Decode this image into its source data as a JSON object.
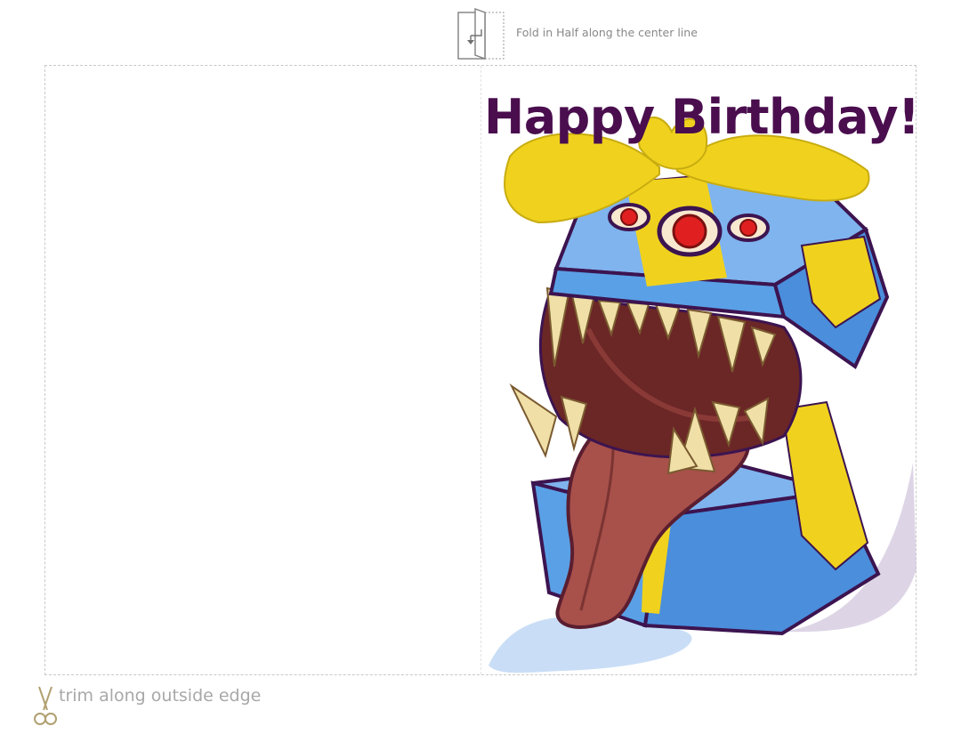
{
  "fold_instruction": {
    "icon": "fold-icon",
    "text": "Fold in Half along the center line"
  },
  "card": {
    "front_title": "Happy Birthday!",
    "illustration": "gift-box-mimic-monster",
    "colors": {
      "title": "#4a0e4e",
      "box_blue": "#5aa0e6",
      "ribbon_yellow": "#f0d21e",
      "outline": "#3c1450",
      "tongue": "#a8504a",
      "mouth": "#6b2626",
      "teeth": "#f0e0a8",
      "eye_red": "#e02020"
    }
  },
  "trim_instruction": {
    "icon": "scissors-icon",
    "text": "trim along outside edge"
  }
}
